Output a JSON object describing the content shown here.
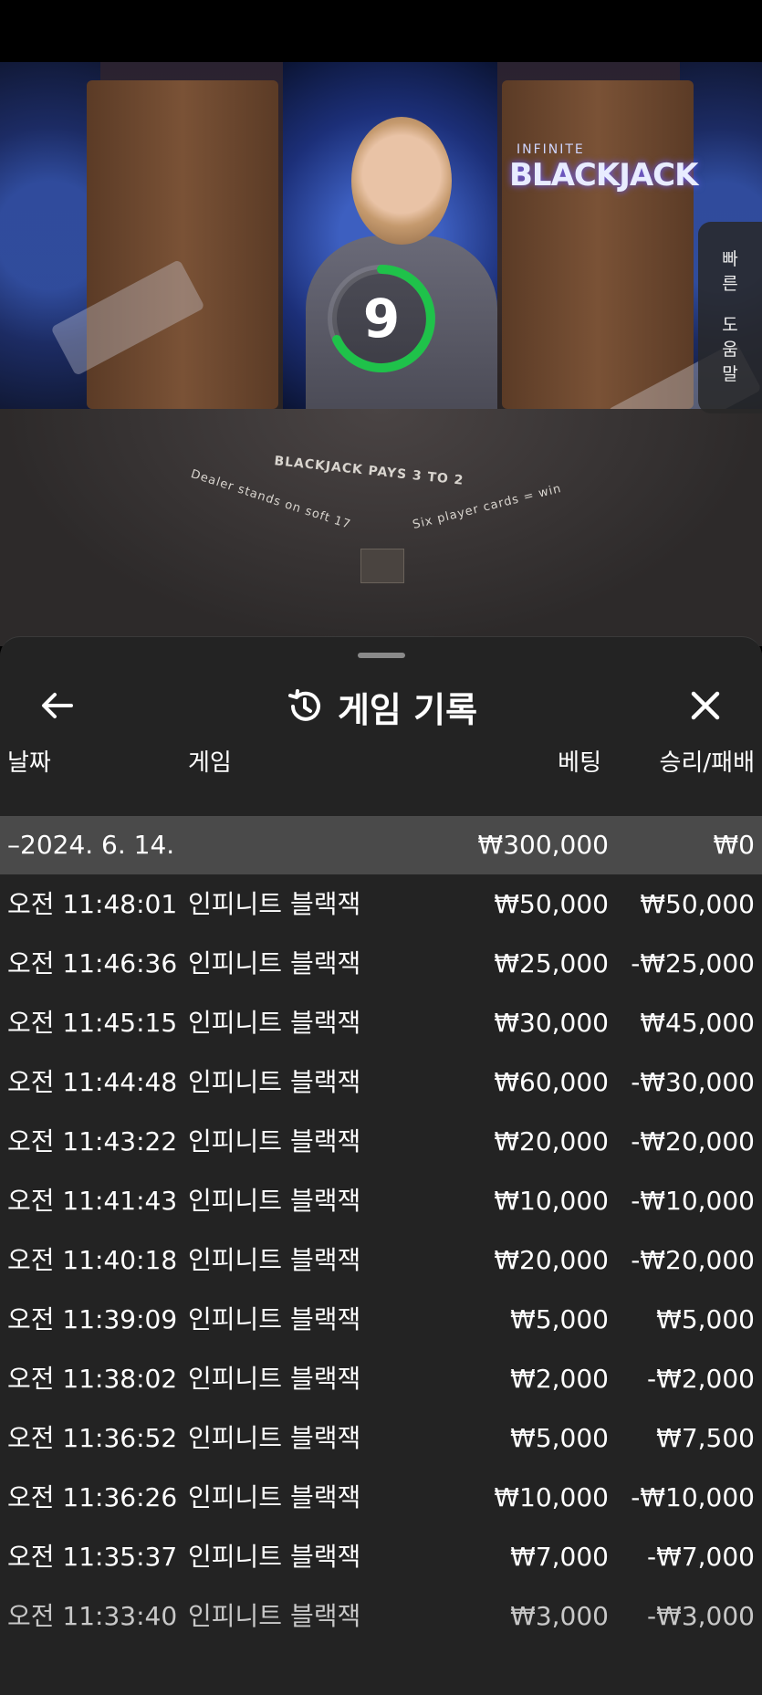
{
  "video": {
    "logo_small": "INFINITE",
    "logo_big": "BLACKJACK",
    "timer": "9",
    "table_main": "BLACKJACK PAYS 3 TO 2",
    "table_left": "Dealer stands on soft 17",
    "table_right": "Six player cards = win",
    "help_tab": [
      "빠",
      "른",
      "도",
      "움",
      "말"
    ]
  },
  "colors": {
    "timer_ring": "#1fc24a",
    "sheet_bg": "#232323",
    "group_row_bg": "#4a4a4a"
  },
  "sheet": {
    "title": "게임 기록",
    "icons": {
      "back": "arrow-left-icon",
      "history": "history-icon",
      "close": "close-icon"
    },
    "columns": {
      "date": "날짜",
      "game": "게임",
      "bet": "베팅",
      "win": "승리/패배"
    },
    "group": {
      "date": "–2024. 6. 14.",
      "bet": "₩300,000",
      "win": "₩0"
    },
    "rows": [
      {
        "time": "오전 11:48:01",
        "game": "인피니트 블랙잭",
        "bet": "₩50,000",
        "win": "₩50,000"
      },
      {
        "time": "오전 11:46:36",
        "game": "인피니트 블랙잭",
        "bet": "₩25,000",
        "win": "-₩25,000"
      },
      {
        "time": "오전 11:45:15",
        "game": "인피니트 블랙잭",
        "bet": "₩30,000",
        "win": "₩45,000"
      },
      {
        "time": "오전 11:44:48",
        "game": "인피니트 블랙잭",
        "bet": "₩60,000",
        "win": "-₩30,000"
      },
      {
        "time": "오전 11:43:22",
        "game": "인피니트 블랙잭",
        "bet": "₩20,000",
        "win": "-₩20,000"
      },
      {
        "time": "오전 11:41:43",
        "game": "인피니트 블랙잭",
        "bet": "₩10,000",
        "win": "-₩10,000"
      },
      {
        "time": "오전 11:40:18",
        "game": "인피니트 블랙잭",
        "bet": "₩20,000",
        "win": "-₩20,000"
      },
      {
        "time": "오전 11:39:09",
        "game": "인피니트 블랙잭",
        "bet": "₩5,000",
        "win": "₩5,000"
      },
      {
        "time": "오전 11:38:02",
        "game": "인피니트 블랙잭",
        "bet": "₩2,000",
        "win": "-₩2,000"
      },
      {
        "time": "오전 11:36:52",
        "game": "인피니트 블랙잭",
        "bet": "₩5,000",
        "win": "₩7,500"
      },
      {
        "time": "오전 11:36:26",
        "game": "인피니트 블랙잭",
        "bet": "₩10,000",
        "win": "-₩10,000"
      },
      {
        "time": "오전 11:35:37",
        "game": "인피니트 블랙잭",
        "bet": "₩7,000",
        "win": "-₩7,000"
      },
      {
        "time": "오전 11:33:40",
        "game": "인피니트 블랙잭",
        "bet": "₩3,000",
        "win": "-₩3,000"
      }
    ]
  }
}
